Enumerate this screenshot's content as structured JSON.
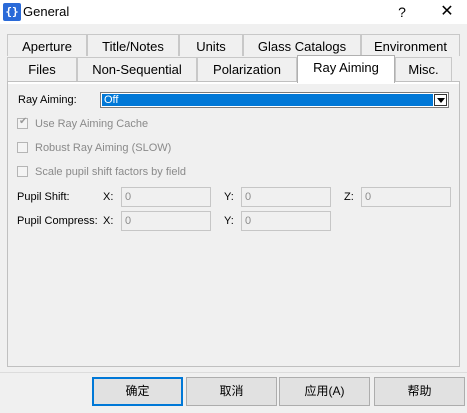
{
  "window": {
    "icon_glyph": "{}",
    "title": "General",
    "help": "?",
    "close": "✕"
  },
  "tabs_row1": [
    "Aperture",
    "Title/Notes",
    "Units",
    "Glass Catalogs",
    "Environment"
  ],
  "tabs_row2": [
    "Files",
    "Non-Sequential",
    "Polarization",
    "Ray Aiming",
    "Misc."
  ],
  "active_tab": "Ray Aiming",
  "ray_aiming": {
    "label": "Ray Aiming:",
    "selected": "Off",
    "options_cache": {
      "label": "Use Ray Aiming Cache",
      "checked": true,
      "enabled": false
    },
    "robust": {
      "label": "Robust Ray Aiming (SLOW)",
      "checked": false,
      "enabled": false
    },
    "scale": {
      "label": "Scale pupil shift factors by field",
      "checked": false,
      "enabled": false
    },
    "pupil_shift": {
      "label": "Pupil Shift:",
      "x_label": "X:",
      "x": "0",
      "y_label": "Y:",
      "y": "0",
      "z_label": "Z:",
      "z": "0"
    },
    "pupil_compress": {
      "label": "Pupil Compress:",
      "x_label": "X:",
      "x": "0",
      "y_label": "Y:",
      "y": "0"
    }
  },
  "buttons": {
    "ok": "确定",
    "cancel": "取消",
    "apply": "应用(A)",
    "help": "帮助"
  },
  "colors": {
    "accent": "#0078d7",
    "window_bg": "#f0f0f0"
  }
}
